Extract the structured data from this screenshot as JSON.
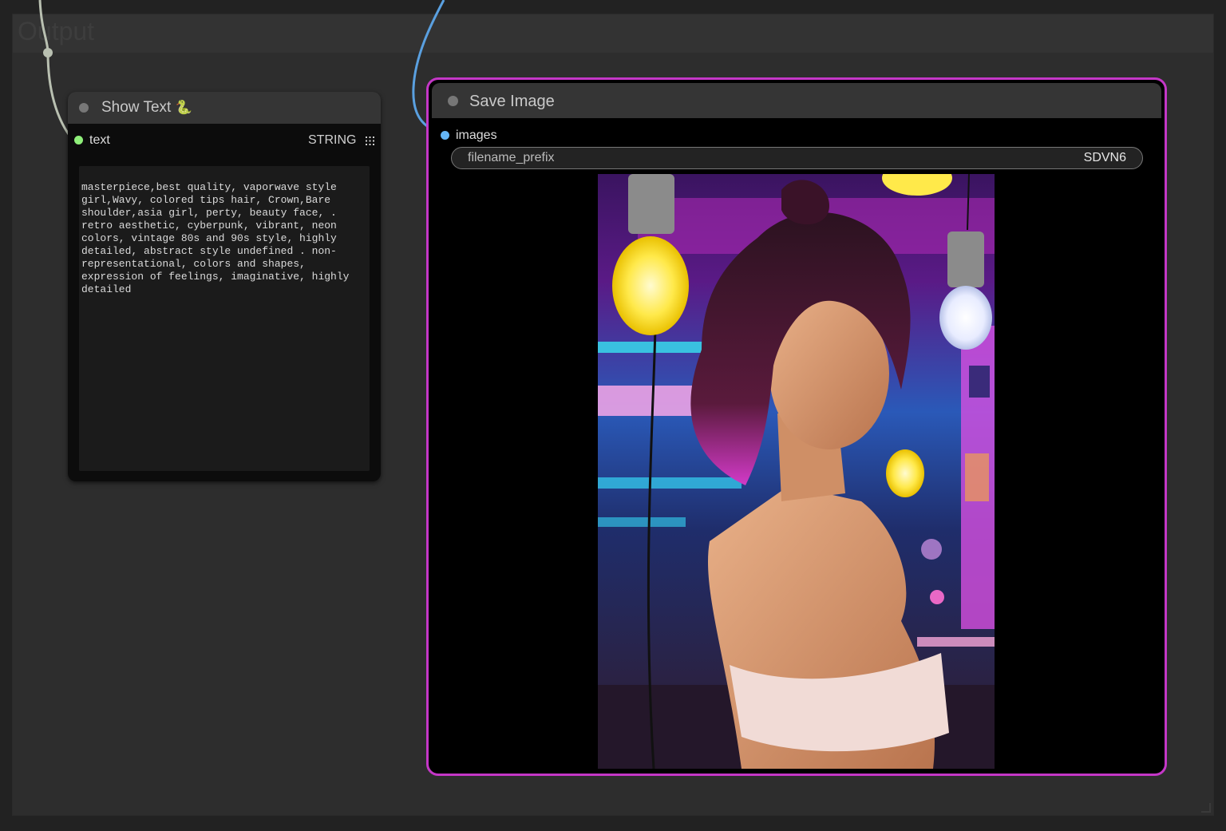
{
  "group": {
    "title": "Output"
  },
  "show_text_node": {
    "title": "Show Text",
    "title_icon": "snake-emoji",
    "title_icon_glyph": "🐍",
    "input": {
      "name": "text",
      "type": "STRING"
    },
    "text_content": "masterpiece,best quality, vaporwave style girl,Wavy, colored tips hair, Crown,Bare shoulder,asia girl, perty, beauty face, . retro aesthetic, cyberpunk, vibrant, neon colors, vintage 80s and 90s style, highly detailed, abstract style undefined . non-representational, colors and shapes, expression of feelings, imaginative, highly detailed"
  },
  "save_image_node": {
    "title": "Save Image",
    "input": {
      "name": "images"
    },
    "widget": {
      "name": "filename_prefix",
      "value": "SDVN6"
    },
    "preview_image": "vaporwave-girl-neon-lightbulbs"
  },
  "colors": {
    "selected_border": "#c437c7",
    "string_slot": "#8fef7a",
    "image_slot": "#64b5f6",
    "image_link": "#5aa0e0",
    "string_link": "#b9c0b1"
  }
}
